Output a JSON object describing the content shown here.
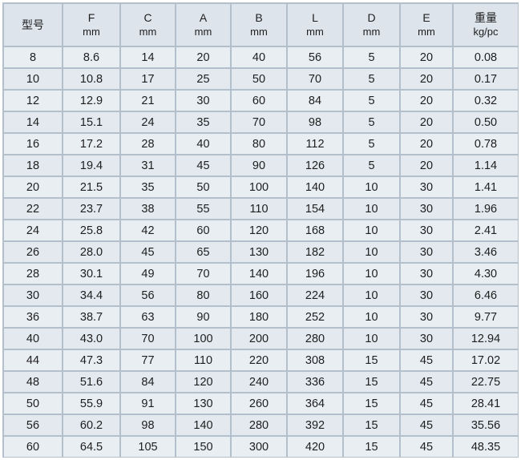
{
  "columns": [
    {
      "name": "型号",
      "unit": ""
    },
    {
      "name": "F",
      "unit": "mm"
    },
    {
      "name": "C",
      "unit": "mm"
    },
    {
      "name": "A",
      "unit": "mm"
    },
    {
      "name": "B",
      "unit": "mm"
    },
    {
      "name": "L",
      "unit": "mm"
    },
    {
      "name": "D",
      "unit": "mm"
    },
    {
      "name": "E",
      "unit": "mm"
    },
    {
      "name": "重量",
      "unit": "kg/pc"
    }
  ],
  "rows": [
    [
      "8",
      "8.6",
      "14",
      "20",
      "40",
      "56",
      "5",
      "20",
      "0.08"
    ],
    [
      "10",
      "10.8",
      "17",
      "25",
      "50",
      "70",
      "5",
      "20",
      "0.17"
    ],
    [
      "12",
      "12.9",
      "21",
      "30",
      "60",
      "84",
      "5",
      "20",
      "0.32"
    ],
    [
      "14",
      "15.1",
      "24",
      "35",
      "70",
      "98",
      "5",
      "20",
      "0.50"
    ],
    [
      "16",
      "17.2",
      "28",
      "40",
      "80",
      "112",
      "5",
      "20",
      "0.78"
    ],
    [
      "18",
      "19.4",
      "31",
      "45",
      "90",
      "126",
      "5",
      "20",
      "1.14"
    ],
    [
      "20",
      "21.5",
      "35",
      "50",
      "100",
      "140",
      "10",
      "30",
      "1.41"
    ],
    [
      "22",
      "23.7",
      "38",
      "55",
      "110",
      "154",
      "10",
      "30",
      "1.96"
    ],
    [
      "24",
      "25.8",
      "42",
      "60",
      "120",
      "168",
      "10",
      "30",
      "2.41"
    ],
    [
      "26",
      "28.0",
      "45",
      "65",
      "130",
      "182",
      "10",
      "30",
      "3.46"
    ],
    [
      "28",
      "30.1",
      "49",
      "70",
      "140",
      "196",
      "10",
      "30",
      "4.30"
    ],
    [
      "30",
      "34.4",
      "56",
      "80",
      "160",
      "224",
      "10",
      "30",
      "6.46"
    ],
    [
      "36",
      "38.7",
      "63",
      "90",
      "180",
      "252",
      "10",
      "30",
      "9.77"
    ],
    [
      "40",
      "43.0",
      "70",
      "100",
      "200",
      "280",
      "10",
      "30",
      "12.94"
    ],
    [
      "44",
      "47.3",
      "77",
      "110",
      "220",
      "308",
      "15",
      "45",
      "17.02"
    ],
    [
      "48",
      "51.6",
      "84",
      "120",
      "240",
      "336",
      "15",
      "45",
      "22.75"
    ],
    [
      "50",
      "55.9",
      "91",
      "130",
      "260",
      "364",
      "15",
      "45",
      "28.41"
    ],
    [
      "56",
      "60.2",
      "98",
      "140",
      "280",
      "392",
      "15",
      "45",
      "35.56"
    ],
    [
      "60",
      "64.5",
      "105",
      "150",
      "300",
      "420",
      "15",
      "45",
      "48.35"
    ]
  ]
}
